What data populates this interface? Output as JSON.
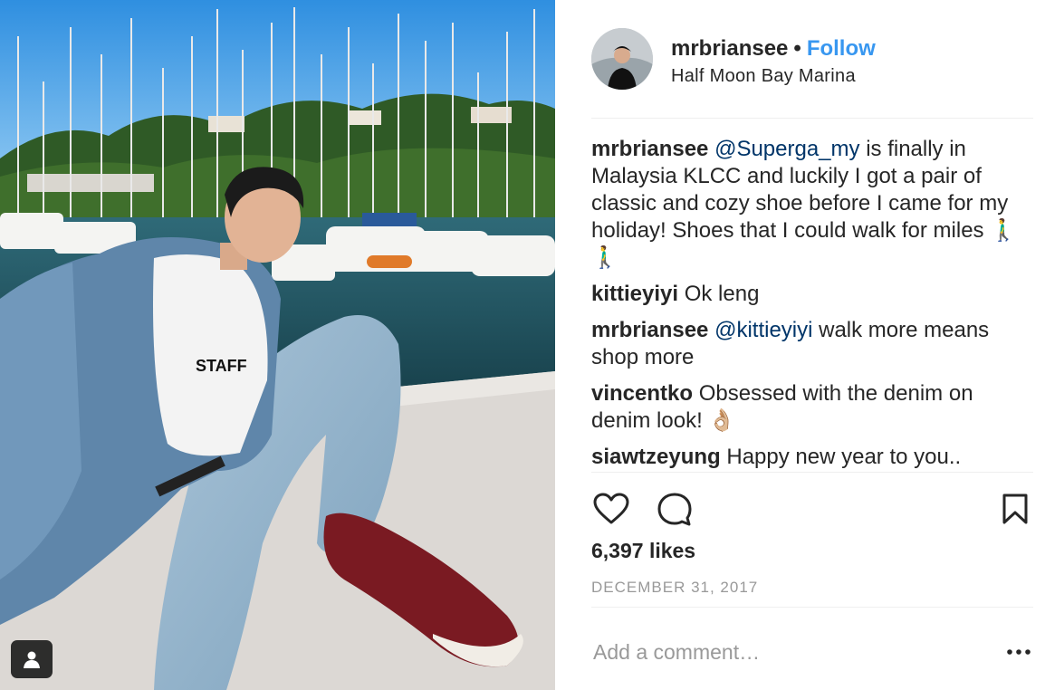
{
  "post": {
    "username": "mrbriansee",
    "separator": "•",
    "follow_label": "Follow",
    "location": "Half Moon Bay Marina",
    "likes": "6,397 likes",
    "date": "DECEMBER 31, 2017",
    "comment_placeholder": "Add a comment…"
  },
  "comments": [
    {
      "user": "mrbriansee",
      "mention": "@Superga_my",
      "text": " is finally in Malaysia KLCC and luckily I got a pair of classic and cozy shoe before I came for my holiday! Shoes that I could walk for miles 🚶‍♂️🚶‍♂️"
    },
    {
      "user": "kittieyiyi",
      "mention": "",
      "text": " Ok leng"
    },
    {
      "user": "mrbriansee",
      "mention": "@kittieyiyi",
      "text": " walk more means shop more"
    },
    {
      "user": "vincentko",
      "mention": "",
      "text": " Obsessed with the denim on denim look! 👌🏼"
    },
    {
      "user": "siawtzeyung",
      "mention": "",
      "text": " Happy new year to you.."
    }
  ],
  "icons": {
    "like": "heart-icon",
    "comment": "comment-icon",
    "save": "bookmark-icon",
    "more": "more-icon",
    "tags": "user-tag-icon"
  },
  "colors": {
    "follow": "#3897f0",
    "mention": "#003569",
    "meta_grey": "#999999",
    "text": "#262626"
  }
}
